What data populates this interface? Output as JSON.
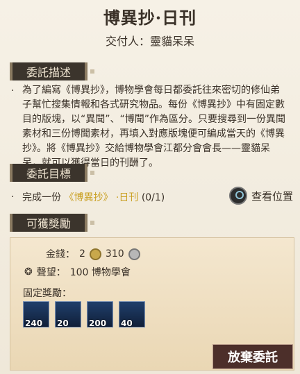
{
  "header": {
    "title": "博異抄·日刊",
    "subtitle": "交付人：靈貓呆呆"
  },
  "sections": {
    "description": "委託描述",
    "objective": "委託目標",
    "rewards": "可獲獎勵"
  },
  "description": {
    "text": "為了編寫《博異抄》，博物學會每日都委託往來密切的修仙弟子幫忙搜集情報和各式研究物品。每份《博異抄》中有固定數目的版塊，以“異聞”、“博聞”作為區分。只要搜尋到一份異聞素材和三份博聞素材，再填入對應版塊便可編成當天的《博異抄》。將《博異抄》交給博物學會江都分會會長——靈貓呆呆，就可以獲得當日的刊酬了。"
  },
  "objective": {
    "prefix": "完成一份",
    "book": "《博異抄》",
    "suffix": "·日刊",
    "progress": "(0/1)",
    "location_label": "查看位置"
  },
  "rewards": {
    "money_label": "金錢：",
    "money_gold": "2",
    "money_silver": "310",
    "reputation_label": "聲望：",
    "reputation_value": "100 博物學會",
    "fixed_label": "固定獎勵：",
    "items": [
      {
        "count": "240",
        "icon": "blue-crystal-icon"
      },
      {
        "count": "20",
        "icon": "blue-crystal-icon"
      },
      {
        "count": "200",
        "icon": "blue-crystal-icon"
      },
      {
        "count": "40",
        "icon": "blue-crystal-icon"
      }
    ]
  },
  "footer": {
    "abandon_button": "放棄委託"
  }
}
